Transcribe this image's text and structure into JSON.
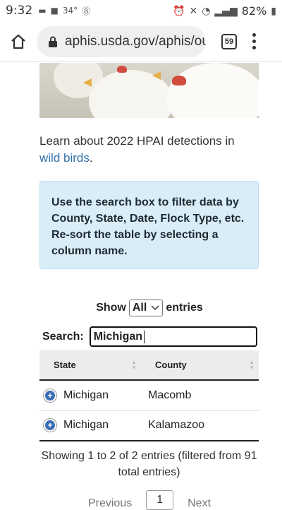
{
  "status": {
    "time": "9:32",
    "temp": "34°",
    "battery": "82%"
  },
  "browser": {
    "url": "aphis.usda.gov/aphis/ou",
    "tab_count": "59"
  },
  "learn": {
    "prefix": "Learn about 2022 HPAI detections in ",
    "link": "wild birds",
    "suffix": "."
  },
  "callout": {
    "text": "Use the search box to filter data by County, State, Date, Flock Type, etc. Re-sort the table by selecting a column name."
  },
  "length": {
    "show": "Show",
    "selected": "All",
    "entries": "entries"
  },
  "search": {
    "label": "Search:",
    "value": "Michigan"
  },
  "table": {
    "headers": [
      "State",
      "County"
    ],
    "rows": [
      {
        "state": "Michigan",
        "county": "Macomb"
      },
      {
        "state": "Michigan",
        "county": "Kalamazoo"
      }
    ]
  },
  "info": {
    "text": "Showing 1 to 2 of 2 entries (filtered from 91 total entries)"
  },
  "pager": {
    "previous": "Previous",
    "current": "1",
    "next": "Next"
  }
}
